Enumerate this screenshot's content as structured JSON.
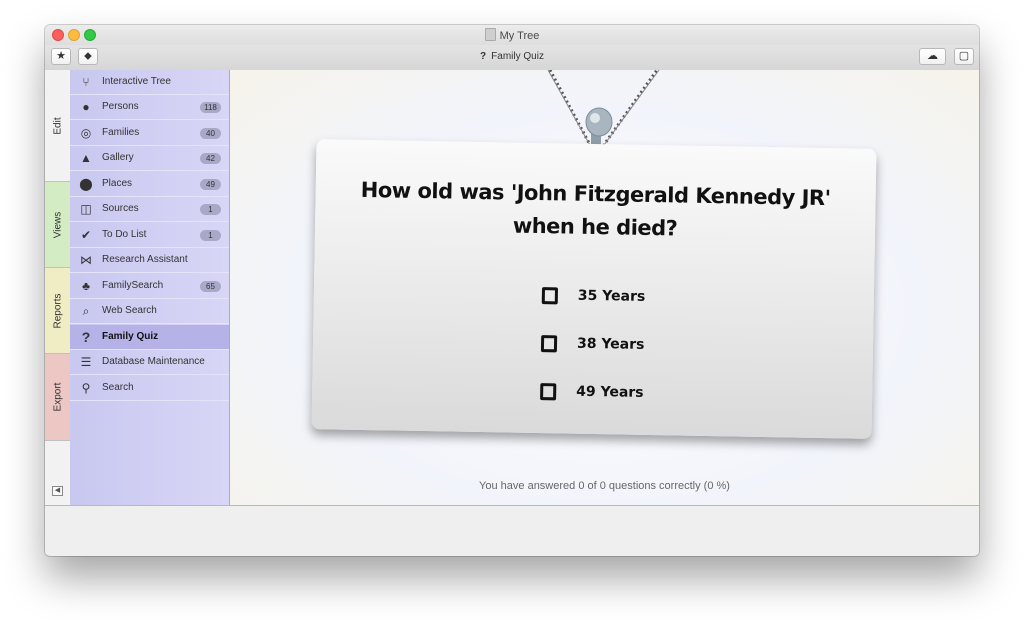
{
  "window": {
    "title": "My Tree"
  },
  "toolbar": {
    "title": "Family Quiz",
    "title_icon": "?"
  },
  "tabs": [
    {
      "label": "Edit",
      "color": "#f2f2f2"
    },
    {
      "label": "Views",
      "color": "#d3ecc4"
    },
    {
      "label": "Reports",
      "color": "#f0ecc4"
    },
    {
      "label": "Export",
      "color": "#ecc7c4"
    }
  ],
  "sidebar": {
    "items": [
      {
        "label": "Interactive Tree",
        "icon": "tree-icon",
        "badge": ""
      },
      {
        "label": "Persons",
        "icon": "person-icon",
        "badge": "118"
      },
      {
        "label": "Families",
        "icon": "rings-icon",
        "badge": "40"
      },
      {
        "label": "Gallery",
        "icon": "gallery-icon",
        "badge": "42"
      },
      {
        "label": "Places",
        "icon": "location-pin-icon",
        "badge": "49"
      },
      {
        "label": "Sources",
        "icon": "book-icon",
        "badge": "1"
      },
      {
        "label": "To Do List",
        "icon": "checkmark-icon",
        "badge": "1"
      },
      {
        "label": "Research Assistant",
        "icon": "bowtie-icon",
        "badge": ""
      },
      {
        "label": "FamilySearch",
        "icon": "familysearch-tree-icon",
        "badge": "65"
      },
      {
        "label": "Web Search",
        "icon": "web-search-icon",
        "badge": ""
      },
      {
        "label": "Family Quiz",
        "icon": "question-mark-icon",
        "badge": ""
      },
      {
        "label": "Database Maintenance",
        "icon": "database-icon",
        "badge": ""
      },
      {
        "label": "Search",
        "icon": "magnifier-icon",
        "badge": ""
      }
    ],
    "selected": "Family Quiz"
  },
  "quiz": {
    "question": "How old was 'John Fitzgerald Kennedy JR' when he died?",
    "answers": [
      "35 Years",
      "38 Years",
      "49 Years"
    ],
    "score_text": "You have answered 0 of 0 questions correctly (0 %)"
  },
  "colors": {
    "sidebar": "#cfcff3",
    "selected": "#b4b2e6",
    "card": "#e6e6e6"
  }
}
